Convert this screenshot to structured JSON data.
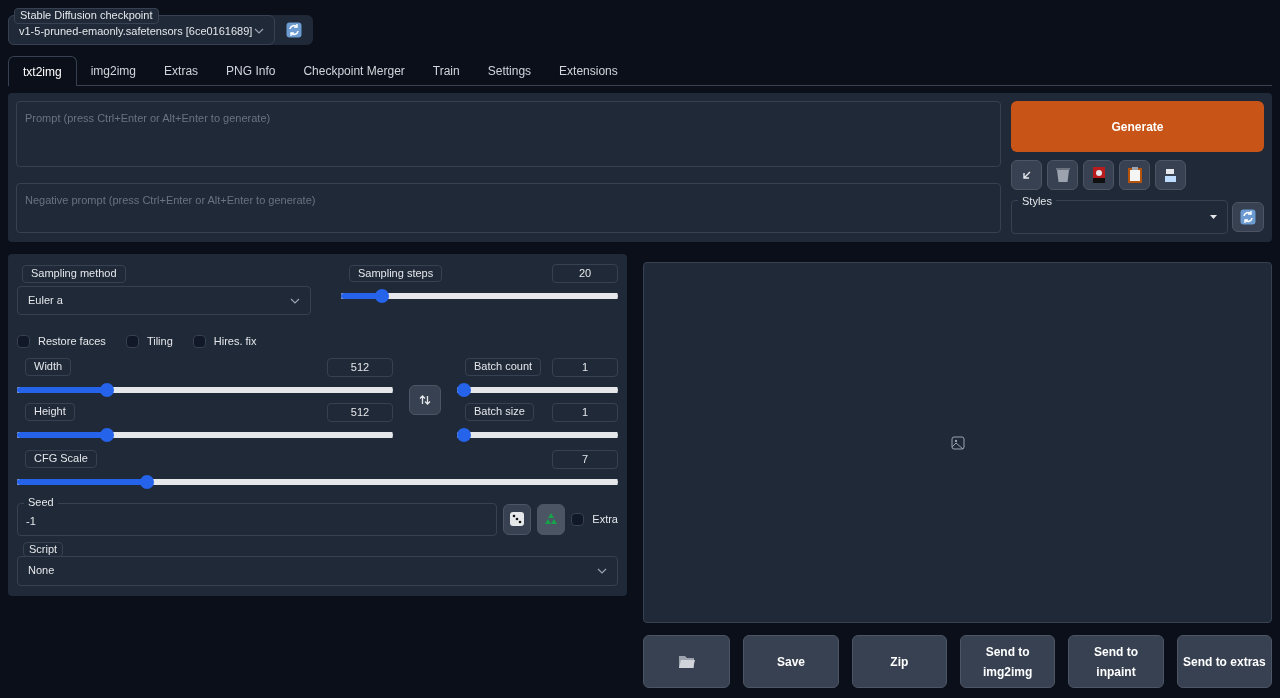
{
  "checkpoint": {
    "label": "Stable Diffusion checkpoint",
    "value": "v1-5-pruned-emaonly.safetensors [6ce0161689]"
  },
  "tabs": [
    {
      "label": "txt2img",
      "selected": true
    },
    {
      "label": "img2img",
      "selected": false
    },
    {
      "label": "Extras",
      "selected": false
    },
    {
      "label": "PNG Info",
      "selected": false
    },
    {
      "label": "Checkpoint Merger",
      "selected": false
    },
    {
      "label": "Train",
      "selected": false
    },
    {
      "label": "Settings",
      "selected": false
    },
    {
      "label": "Extensions",
      "selected": false
    }
  ],
  "prompt": {
    "placeholder": "Prompt (press Ctrl+Enter or Alt+Enter to generate)"
  },
  "negative_prompt": {
    "placeholder": "Negative prompt (press Ctrl+Enter or Alt+Enter to generate)"
  },
  "generate_button": "Generate",
  "styles": {
    "label": "Styles"
  },
  "sampling_method": {
    "label": "Sampling method",
    "value": "Euler a"
  },
  "sampling_steps": {
    "label": "Sampling steps",
    "value": "20",
    "level": 0.13
  },
  "checkboxes": [
    {
      "label": "Restore faces",
      "checked": false
    },
    {
      "label": "Tiling",
      "checked": false
    },
    {
      "label": "Hires. fix",
      "checked": false
    }
  ],
  "width": {
    "label": "Width",
    "value": "512",
    "level": 0.23
  },
  "height": {
    "label": "Height",
    "value": "512",
    "level": 0.23
  },
  "batch_count": {
    "label": "Batch count",
    "value": "1",
    "level": 0
  },
  "batch_size": {
    "label": "Batch size",
    "value": "1",
    "level": 0
  },
  "cfg_scale": {
    "label": "CFG Scale",
    "value": "7",
    "level": 0.21
  },
  "seed": {
    "label": "Seed",
    "value": "-1"
  },
  "extra": {
    "label": "Extra",
    "checked": false
  },
  "script": {
    "label": "Script",
    "value": "None"
  },
  "output_buttons": [
    "Save",
    "Zip",
    "Send to img2img",
    "Send to inpaint",
    "Send to extras"
  ]
}
